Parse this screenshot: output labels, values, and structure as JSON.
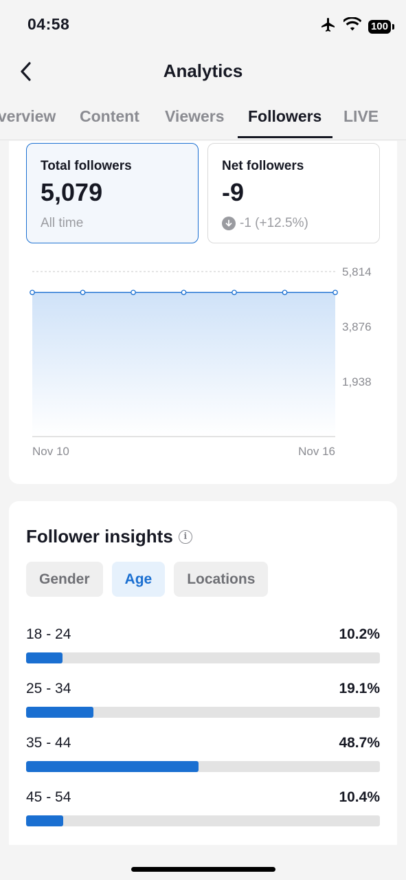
{
  "status_bar": {
    "time": "04:58",
    "battery": "100"
  },
  "nav": {
    "title": "Analytics"
  },
  "tabs": [
    {
      "label": "Overview"
    },
    {
      "label": "Content"
    },
    {
      "label": "Viewers"
    },
    {
      "label": "Followers"
    },
    {
      "label": "LIVE"
    }
  ],
  "active_tab": "Followers",
  "metrics": {
    "total": {
      "label": "Total followers",
      "value": "5,079",
      "sub": "All time"
    },
    "net": {
      "label": "Net followers",
      "value": "-9",
      "sub": "-1 (+12.5%)"
    }
  },
  "chart_data": {
    "type": "area",
    "x": [
      "Nov 10",
      "Nov 11",
      "Nov 12",
      "Nov 13",
      "Nov 14",
      "Nov 15",
      "Nov 16"
    ],
    "x_tick_labels": [
      "Nov 10",
      "Nov 16"
    ],
    "series": [
      {
        "values": [
          5079,
          5079,
          5079,
          5079,
          5079,
          5079,
          5079
        ]
      }
    ],
    "y_ticks": [
      "5,814",
      "3,876",
      "1,938"
    ],
    "y_tick_values": [
      5814,
      3876,
      1938
    ],
    "ylim": [
      0,
      5814
    ],
    "grid": true,
    "colors": {
      "line": "#1a6fd1",
      "fill": "#cfe2f8"
    }
  },
  "insights": {
    "title": "Follower insights",
    "info_icon": "info-icon",
    "chips": [
      {
        "label": "Gender"
      },
      {
        "label": "Age"
      },
      {
        "label": "Locations"
      }
    ],
    "active_chip": "Age",
    "age_groups": [
      {
        "label": "18 - 24",
        "pct": "10.2%",
        "value": 10.2
      },
      {
        "label": "25 - 34",
        "pct": "19.1%",
        "value": 19.1
      },
      {
        "label": "35 - 44",
        "pct": "48.7%",
        "value": 48.7
      },
      {
        "label": "45 - 54",
        "pct": "10.4%",
        "value": 10.4
      }
    ]
  },
  "colors": {
    "accent": "#1a6fd1",
    "track": "#e3e3e3",
    "text": "#161823",
    "muted": "#9a9ba0"
  }
}
